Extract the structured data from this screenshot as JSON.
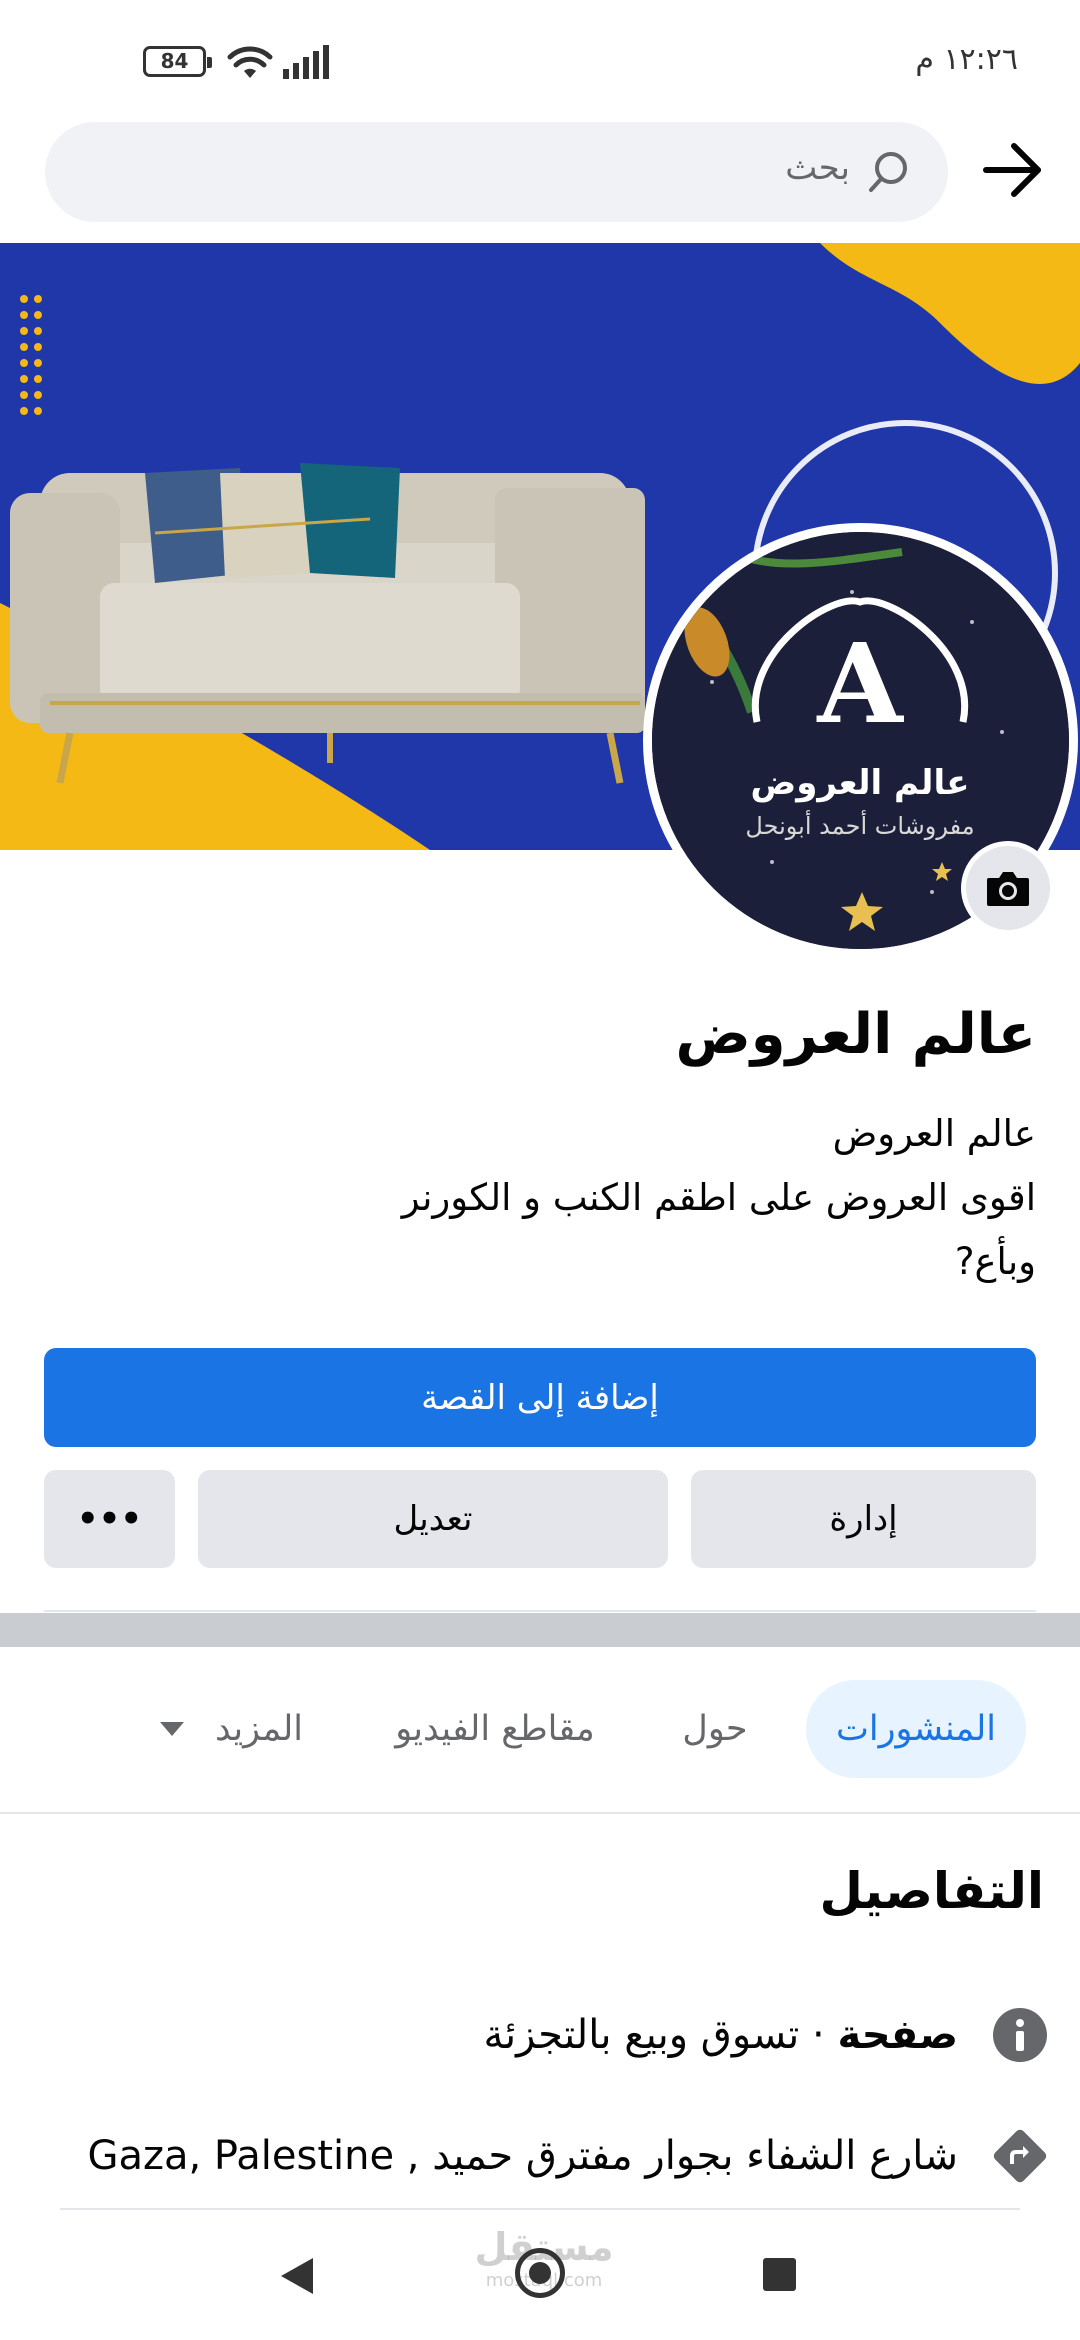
{
  "status_bar": {
    "time": "١٢:٢٦ م",
    "battery": "84"
  },
  "search": {
    "placeholder": "بحث"
  },
  "profile": {
    "name": "عالم العروض",
    "bio_lines": [
      "عالم العروض",
      "اقوى العروض على اطقم الكنب و الكورنر",
      "وبأع?"
    ],
    "logo_title": "عالم العروض",
    "logo_subtitle": "مفروشات أحمد أبونحل",
    "logo_letter": "A"
  },
  "actions": {
    "add_story": "إضافة إلى القصة",
    "manage": "إدارة",
    "edit": "تعديل",
    "more": "•••"
  },
  "tabs": [
    {
      "label": "المنشورات",
      "active": true
    },
    {
      "label": "حول",
      "active": false
    },
    {
      "label": "مقاطع الفيديو",
      "active": false
    },
    {
      "label": "المزيد",
      "active": false
    }
  ],
  "details": {
    "title": "التفاصيل",
    "category_bold": "صفحة",
    "category_rest": " · تسوق وبيع بالتجزئة",
    "address": "شارع الشفاء بجوار مفترق حميد , Gaza, Palestine"
  },
  "watermark": {
    "text": "مستقل",
    "sub": "mostaql.com"
  },
  "colors": {
    "primary": "#1b74e4",
    "cover_blue": "#1f37a8",
    "cover_yellow": "#f5b915",
    "icon_gray": "#65676b"
  }
}
